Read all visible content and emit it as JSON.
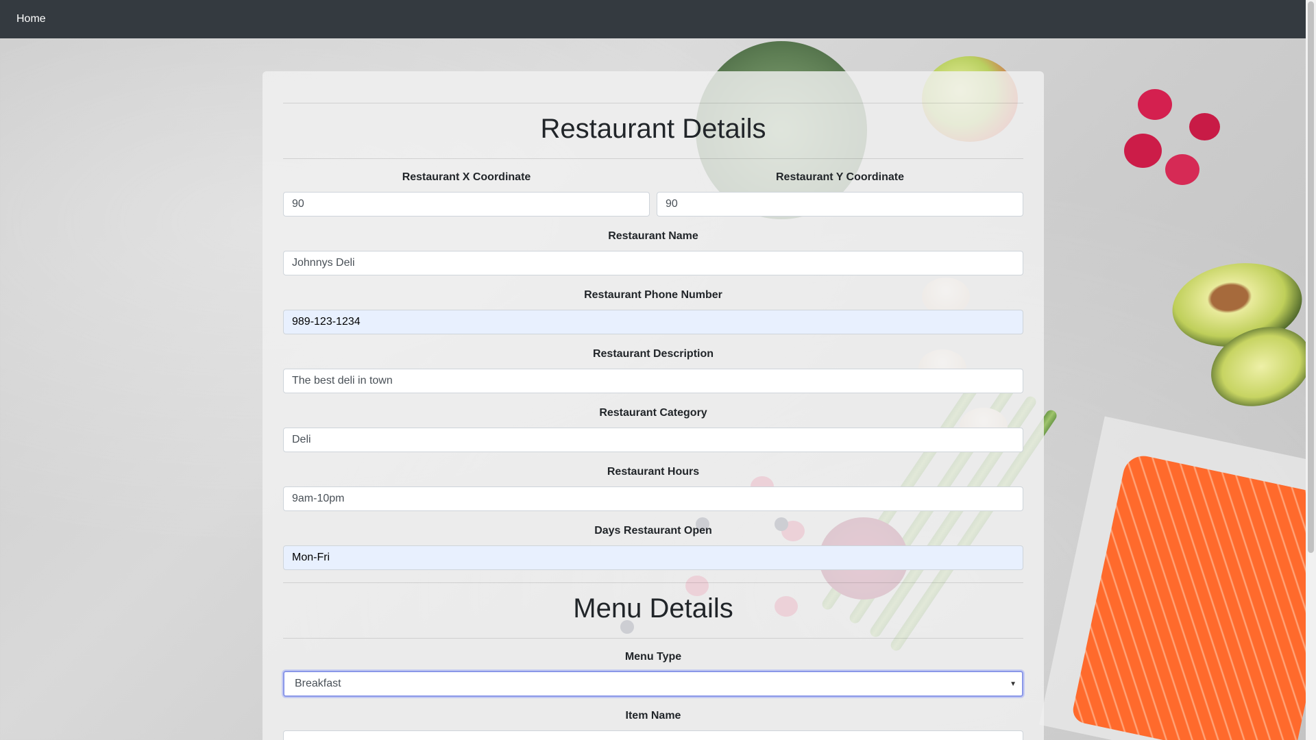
{
  "navbar": {
    "home_label": "Home"
  },
  "restaurant_section": {
    "title": "Restaurant Details",
    "x_coordinate": {
      "label": "Restaurant X Coordinate",
      "value": "90"
    },
    "y_coordinate": {
      "label": "Restaurant Y Coordinate",
      "value": "90"
    },
    "name": {
      "label": "Restaurant Name",
      "value": "Johnnys Deli"
    },
    "phone": {
      "label": "Restaurant Phone Number",
      "value": "989-123-1234"
    },
    "description": {
      "label": "Restaurant Description",
      "value": "The best deli in town"
    },
    "category": {
      "label": "Restaurant Category",
      "value": "Deli"
    },
    "hours": {
      "label": "Restaurant Hours",
      "value": "9am-10pm"
    },
    "days_open": {
      "label": "Days Restaurant Open",
      "value": "Mon-Fri"
    }
  },
  "menu_section": {
    "title": "Menu Details",
    "menu_type": {
      "label": "Menu Type",
      "selected": "Breakfast"
    },
    "item_name": {
      "label": "Item Name"
    }
  },
  "colors": {
    "navbar_bg": "#343a40",
    "focus_outline": "#8a97e8",
    "autofill_bg": "#e8f0fe"
  }
}
